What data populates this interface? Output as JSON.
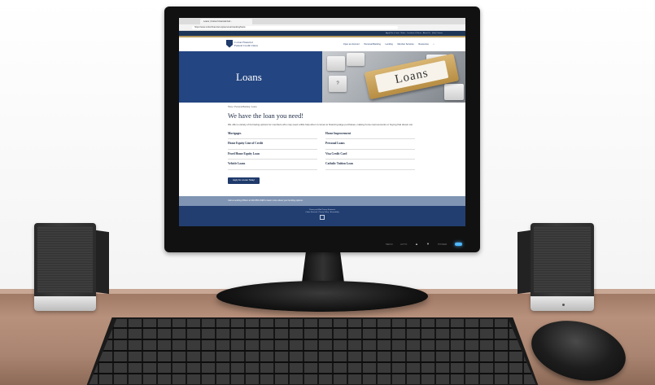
{
  "browser": {
    "tab_title": "Loans | Cotton Financial Fed...",
    "url": "https://www.cottonfinancial.org/personal-banking/loans"
  },
  "site": {
    "utility_nav": "Apply For a Loan  ·  Rates  ·  Locations & Hours  ·  About Us  ·  (Get) Contact",
    "logo_line1": "Cotton Financial",
    "logo_line2": "Federal Credit Union",
    "nav": [
      "Open an Account",
      "Personal Banking",
      "Lending",
      "Member Services",
      "Resources"
    ]
  },
  "hero": {
    "title": "Loans",
    "key_label": "Loans"
  },
  "content": {
    "breadcrumb": "Home / Personal Banking / Loans",
    "heading": "We have the loan you need!",
    "intro": "We offer a variety of borrowing options for members who may need a little help when it comes to financing large purchases, making home improvements or buying that dream car.",
    "loans_left": [
      "Mortgages",
      "Home Equity Line of Credit",
      "Fixed Home Equity Loan",
      "Vehicle Loans"
    ],
    "loans_right": [
      "Home Improvement",
      "Personal Loans",
      "Visa Credit Card",
      "Catholic Tuition Loan"
    ],
    "apply_label": "Apply for a Loan Today!"
  },
  "callbar": "Call a Lending Officer at 318-555-0198 to learn more about your lending options.",
  "footer": {
    "line1": "Privacy and Web Privacy Statement",
    "line2": "Cotton Financial  ·  Privacy Policy  ·  Accessibility"
  },
  "monitor": {
    "controls": [
      "MENU",
      "AUTO",
      "▲",
      "▼",
      "POWER"
    ]
  }
}
